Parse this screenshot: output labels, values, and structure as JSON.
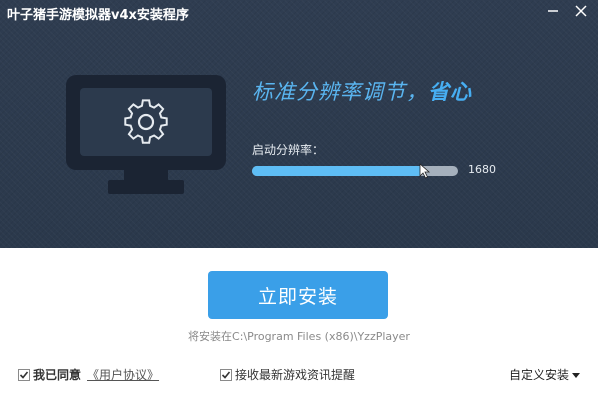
{
  "window": {
    "title": "叶子猪手游模拟器v4x安装程序",
    "minimize_icon": "minimize-icon",
    "close_icon": "close-icon"
  },
  "hero": {
    "headline_main": "标准分辨率调节，",
    "headline_emphasis": "省心",
    "monitor_icon": "monitor-gear-icon"
  },
  "resolution": {
    "label": "启动分辨率：",
    "value": "1680",
    "slider_fraction": 0.83
  },
  "install": {
    "button_label": "立即安装",
    "path_text": "将安装在C:\\Program Files (x86)\\YzzPlayer"
  },
  "options": {
    "agree_label": "我已同意",
    "agreement_link": "《用户协议》",
    "agree_checked": true,
    "news_label": "接收最新游戏资讯提醒",
    "news_checked": true,
    "custom_install_label": "自定义安装",
    "custom_install_icon": "caret-down-icon"
  },
  "colors": {
    "header_bg": "#2d3b4e",
    "accent": "#3a9fe8",
    "headline": "#5ab5f0",
    "slider_fill": "#5ebdf5"
  }
}
